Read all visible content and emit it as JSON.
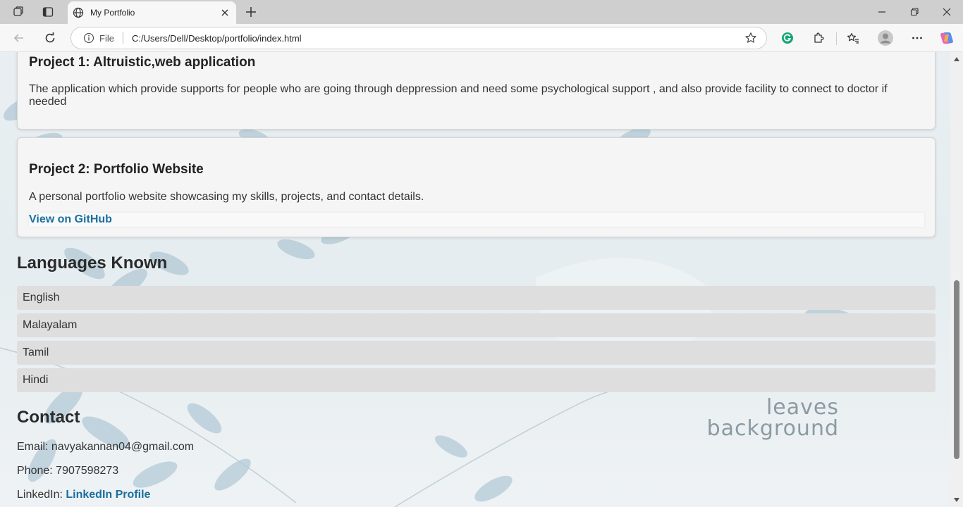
{
  "browser": {
    "tab_title": "My Portfolio",
    "url_scheme": "File",
    "url": "C:/Users/Dell/Desktop/portfolio/index.html",
    "icons": [
      "workspaces-icon",
      "tab-actions-icon",
      "globe-icon",
      "close-icon",
      "new-tab-icon",
      "minimize-icon",
      "restore-icon",
      "window-close-icon",
      "back-icon",
      "refresh-icon",
      "info-icon",
      "favorite-star-icon",
      "grammarly-icon",
      "extensions-icon",
      "favorites-icon",
      "profile-avatar-icon",
      "more-icon",
      "copilot-icon"
    ]
  },
  "projects": [
    {
      "title": "Project 1: Altruistic,web application",
      "description": "The application which provide supports for people who are going through deppression and need some psychological support , and also provide facility to connect to doctor if needed"
    },
    {
      "title": "Project 2: Portfolio Website",
      "description": "A personal portfolio website showcasing my skills, projects, and contact details.",
      "link_label": "View on GitHub"
    }
  ],
  "languages": {
    "heading": "Languages Known",
    "items": [
      "English",
      "Malayalam",
      "Tamil",
      "Hindi"
    ]
  },
  "contact": {
    "heading": "Contact",
    "email_label": "Email:",
    "email": "navyakannan04@gmail.com",
    "phone_label": "Phone:",
    "phone": "7907598273",
    "linkedin_label": "LinkedIn:",
    "linkedin_link": "LinkedIn Profile"
  },
  "background": {
    "watermark_line1": "leaves",
    "watermark_line2": "background"
  },
  "colors": {
    "link": "#1a6fa1",
    "leaf": "#9fbccd"
  }
}
